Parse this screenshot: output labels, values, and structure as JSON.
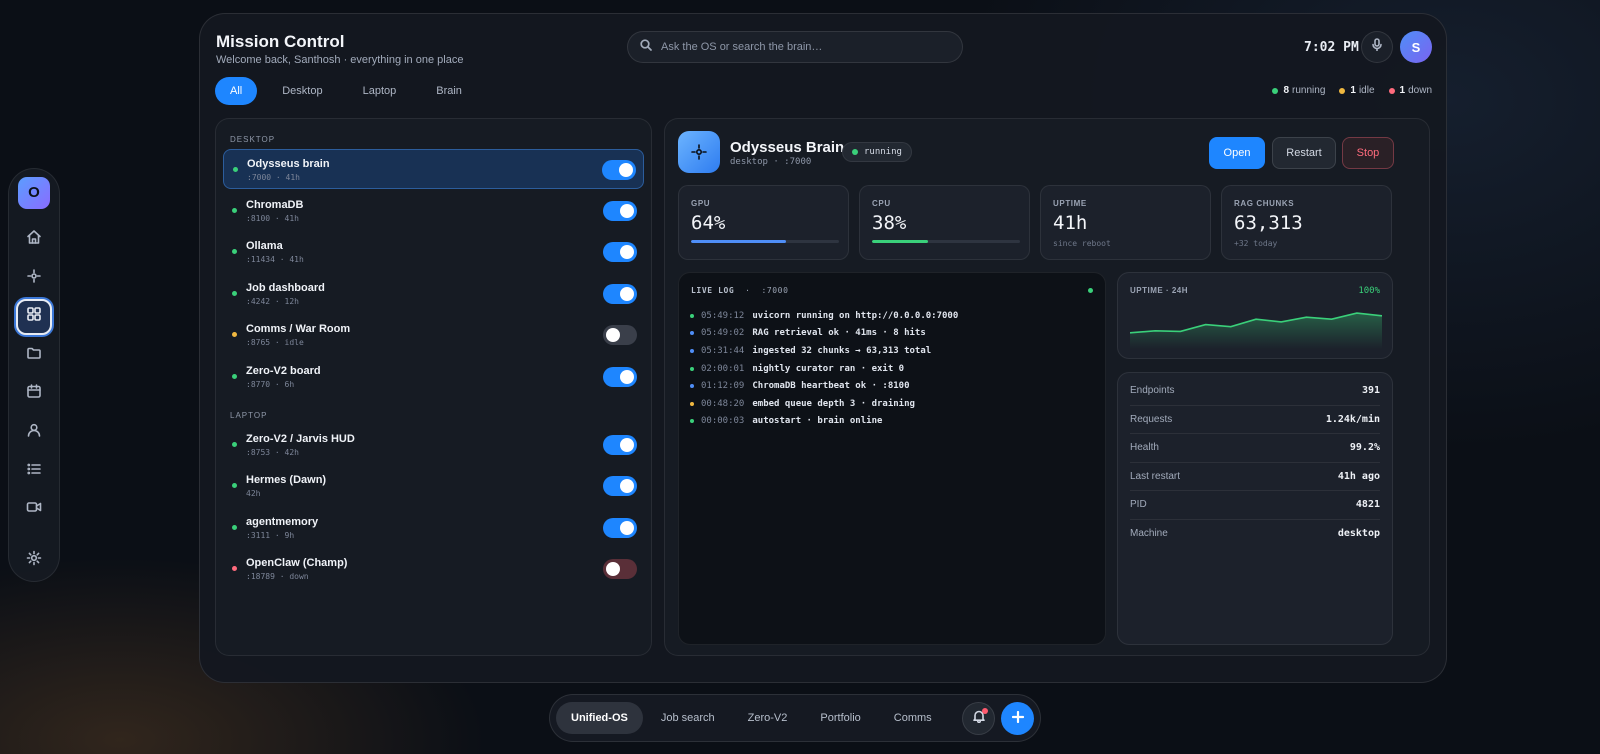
{
  "colors": {
    "accent": "#1e86ff",
    "running": "#3ad07a",
    "idle": "#f0b840",
    "down": "#ff6b7d",
    "info": "#4f8ef7"
  },
  "rail": {
    "logo": "O",
    "items": [
      {
        "icon": "home-icon"
      },
      {
        "icon": "brain-icon"
      },
      {
        "icon": "grid-icon",
        "active": true
      },
      {
        "icon": "folder-icon"
      },
      {
        "icon": "calendar-icon"
      },
      {
        "icon": "user-icon"
      },
      {
        "icon": "list-icon"
      },
      {
        "icon": "video-icon"
      },
      {
        "icon": "gear-icon"
      }
    ]
  },
  "header": {
    "title": "Mission Control",
    "subtitle": "Welcome back, Santhosh · everything in one place",
    "search_placeholder": "Ask the OS or search the brain…",
    "time": "7:02 PM",
    "avatar_initial": "S"
  },
  "tabs": [
    "All",
    "Desktop",
    "Laptop",
    "Brain"
  ],
  "summary": [
    {
      "count": "8",
      "label": "running",
      "status": "running"
    },
    {
      "count": "1",
      "label": "idle",
      "status": "idle"
    },
    {
      "count": "1",
      "label": "down",
      "status": "down"
    }
  ],
  "groups": [
    {
      "label": "DESKTOP",
      "services": [
        {
          "name": "Odysseus brain",
          "meta": ":7000 · 41h",
          "status": "running",
          "on": true,
          "selected": true
        },
        {
          "name": "ChromaDB",
          "meta": ":8100 · 41h",
          "status": "running",
          "on": true
        },
        {
          "name": "Ollama",
          "meta": ":11434 · 41h",
          "status": "running",
          "on": true
        },
        {
          "name": "Job dashboard",
          "meta": ":4242 · 12h",
          "status": "running",
          "on": true
        },
        {
          "name": "Comms / War Room",
          "meta": ":8765 · idle",
          "status": "idle",
          "on": false
        },
        {
          "name": "Zero-V2 board",
          "meta": ":8770 · 6h",
          "status": "running",
          "on": true
        }
      ]
    },
    {
      "label": "LAPTOP",
      "services": [
        {
          "name": "Zero-V2 / Jarvis HUD",
          "meta": ":8753 · 42h",
          "status": "running",
          "on": true
        },
        {
          "name": "Hermes (Dawn)",
          "meta": "42h",
          "status": "running",
          "on": true
        },
        {
          "name": "agentmemory",
          "meta": ":3111 · 9h",
          "status": "running",
          "on": true
        },
        {
          "name": "OpenClaw (Champ)",
          "meta": ":18789 · down",
          "status": "down",
          "on": false
        }
      ]
    }
  ],
  "detail": {
    "name": "Odysseus Brain",
    "sub": "desktop · :7000",
    "status": "running",
    "buttons": {
      "open": "Open",
      "restart": "Restart",
      "stop": "Stop"
    },
    "stats": [
      {
        "label": "GPU",
        "value": "64%",
        "progress": 0.64,
        "color": "#4f8ef7"
      },
      {
        "label": "CPU",
        "value": "38%",
        "progress": 0.38,
        "color": "#3ad07a"
      },
      {
        "label": "UPTIME",
        "value": "41h",
        "note": "since reboot"
      },
      {
        "label": "RAG CHUNKS",
        "value": "63,313",
        "note": "+32 today"
      }
    ],
    "log": {
      "title": "LIVE LOG",
      "port": ":7000",
      "lines": [
        {
          "time": "05:49:12",
          "msg": "uvicorn running on http://0.0.0.0:7000",
          "level": "running"
        },
        {
          "time": "05:49:02",
          "msg": "RAG retrieval ok · 41ms · 8 hits",
          "level": "info"
        },
        {
          "time": "05:31:44",
          "msg": "ingested 32 chunks → 63,313 total",
          "level": "info"
        },
        {
          "time": "02:00:01",
          "msg": "nightly curator ran · exit 0",
          "level": "running"
        },
        {
          "time": "01:12:09",
          "msg": "ChromaDB heartbeat ok · :8100",
          "level": "info"
        },
        {
          "time": "00:48:20",
          "msg": "embed queue depth 3 · draining",
          "level": "idle"
        },
        {
          "time": "00:00:03",
          "msg": "autostart · brain online",
          "level": "running"
        }
      ]
    },
    "uptime": {
      "label": "UPTIME · 24H",
      "percent": "100%",
      "series": [
        0.3,
        0.36,
        0.34,
        0.54,
        0.48,
        0.7,
        0.62,
        0.76,
        0.7,
        0.88,
        0.8
      ]
    },
    "info": [
      {
        "k": "Endpoints",
        "v": "391"
      },
      {
        "k": "Requests",
        "v": "1.24k/min"
      },
      {
        "k": "Health",
        "v": "99.2%"
      },
      {
        "k": "Last restart",
        "v": "41h ago"
      },
      {
        "k": "PID",
        "v": "4821"
      },
      {
        "k": "Machine",
        "v": "desktop"
      }
    ]
  },
  "dock": {
    "tabs": [
      {
        "label": "Unified-OS",
        "active": true
      },
      {
        "label": "Job search"
      },
      {
        "label": "Zero-V2"
      },
      {
        "label": "Portfolio"
      },
      {
        "label": "Comms"
      }
    ]
  }
}
